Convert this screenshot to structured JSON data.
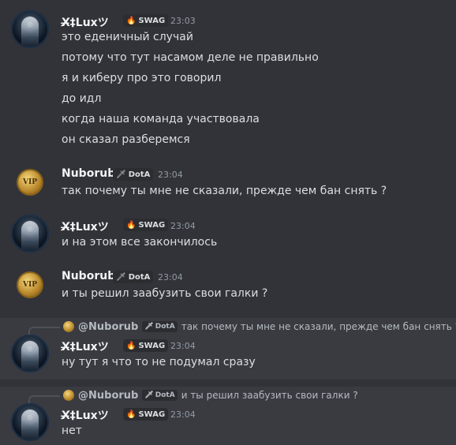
{
  "users": {
    "lux": {
      "name": "X̸̶̸‡Luxツ",
      "tag": "SWAG",
      "tag_icon": "fire-icon"
    },
    "nuborub": {
      "name": "Nuborub",
      "tag": "DotA",
      "tag_icon": "sword-icon",
      "avatar_text": "VIP"
    }
  },
  "messages": [
    {
      "author": "lux",
      "time": "23:03",
      "lines": [
        "это еденичный случай",
        "потому что тут насамом деле не правильно",
        "я и киберу про это говорил",
        "до идл",
        "когда наша команда участвовала",
        "он сказал разберемся"
      ]
    },
    {
      "author": "nuborub",
      "time": "23:04",
      "lines": [
        "так почему ты мне не сказали, прежде чем бан снять ?"
      ]
    },
    {
      "author": "lux",
      "time": "23:04",
      "lines": [
        "и на этом все закончилось"
      ]
    },
    {
      "author": "nuborub",
      "time": "23:04",
      "lines": [
        "и ты решил заабузить свои галки ?"
      ]
    },
    {
      "author": "lux",
      "time": "23:04",
      "reply": {
        "name": "@Nuborub",
        "tag": "DotA",
        "text": "так почему ты мне не сказали, прежде чем бан снять ?"
      },
      "lines": [
        "ну тут я что то не подумал сразу"
      ]
    },
    {
      "author": "lux",
      "time": "23:04",
      "reply": {
        "name": "@Nuborub",
        "tag": "DotA",
        "text": "и ты решил заабузить свои галки ?"
      },
      "lines": [
        "нет"
      ]
    }
  ]
}
